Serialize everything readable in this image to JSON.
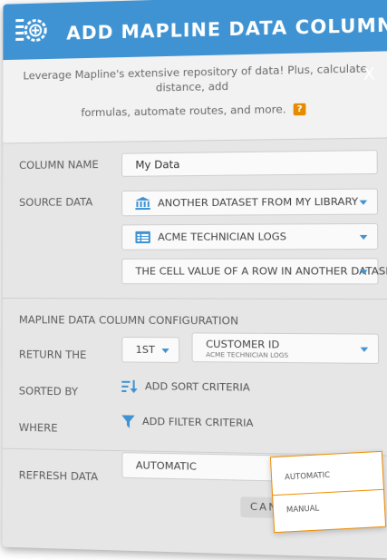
{
  "header": {
    "title": "ADD MAPLINE DATA COLUMN",
    "close": "X"
  },
  "intro": {
    "line1": "Leverage Mapline's extensive repository of data! Plus, calculate distance, add",
    "line2": "formulas, automate routes, and more.",
    "help": "?"
  },
  "fields": {
    "column_name": {
      "label": "COLUMN NAME",
      "value": "My Data"
    },
    "source_data": {
      "label": "SOURCE DATA",
      "source": "ANOTHER DATASET FROM MY LIBRARY",
      "dataset": "ACME TECHNICIAN LOGS",
      "cell": "THE CELL VALUE OF A ROW IN ANOTHER DATASET"
    }
  },
  "config": {
    "heading": "MAPLINE DATA COLUMN CONFIGURATION",
    "return": {
      "label": "RETURN THE",
      "ordinal": "1ST",
      "field": "CUSTOMER ID",
      "field_sub": "ACME TECHNICIAN LOGS"
    },
    "sort": {
      "label": "SORTED BY",
      "action": "ADD SORT CRITERIA"
    },
    "where": {
      "label": "WHERE",
      "action": "ADD FILTER CRITERIA"
    }
  },
  "refresh": {
    "label": "REFRESH DATA",
    "value": "AUTOMATIC",
    "options": [
      "AUTOMATIC",
      "MANUAL"
    ]
  },
  "footer": {
    "cancel": "CANCEL"
  },
  "colors": {
    "brand": "#3f93d3",
    "accent": "#f08c00"
  }
}
